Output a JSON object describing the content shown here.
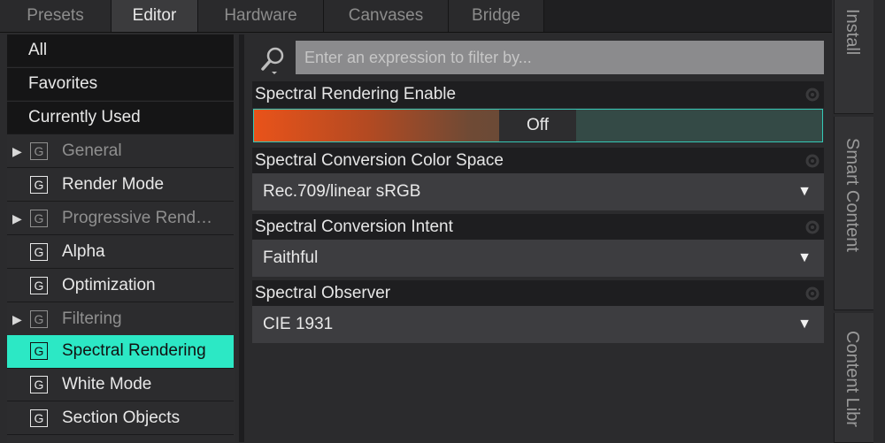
{
  "tabs": [
    "Presets",
    "Editor",
    "Hardware",
    "Canvases",
    "Bridge"
  ],
  "active_tab": "Editor",
  "categories": [
    {
      "label": "All"
    },
    {
      "label": "Favorites"
    },
    {
      "label": "Currently Used"
    },
    {
      "label": "General",
      "group_icon": "G",
      "expandable": true
    },
    {
      "label": "Render Mode",
      "group_icon": "G"
    },
    {
      "label": "Progressive Rend…",
      "group_icon": "G",
      "expandable": true
    },
    {
      "label": "Alpha",
      "group_icon": "G"
    },
    {
      "label": "Optimization",
      "group_icon": "G"
    },
    {
      "label": "Filtering",
      "group_icon": "G",
      "expandable": true
    },
    {
      "label": "Spectral Rendering",
      "group_icon": "G",
      "selected": true
    },
    {
      "label": "White Mode",
      "group_icon": "G"
    },
    {
      "label": "Section Objects",
      "group_icon": "G"
    }
  ],
  "search": {
    "placeholder": "Enter an expression to filter by..."
  },
  "properties": {
    "spectral_enable": {
      "label": "Spectral Rendering Enable",
      "value": "Off"
    },
    "color_space": {
      "label": "Spectral Conversion Color Space",
      "value": "Rec.709/linear sRGB"
    },
    "intent": {
      "label": "Spectral Conversion Intent",
      "value": "Faithful"
    },
    "observer": {
      "label": "Spectral Observer",
      "value": "CIE 1931"
    }
  },
  "side_tabs": [
    "Install",
    "Smart Content",
    "Content Libr"
  ],
  "colors": {
    "accent_selected": "#2ce8c5",
    "toggle_border": "#35c8b6",
    "toggle_orange": "#e9531a"
  },
  "icons": {
    "search": "search-icon",
    "gear": "gear-icon",
    "dropdown": "chevron-down-icon",
    "expand": "triangle-right-icon"
  }
}
